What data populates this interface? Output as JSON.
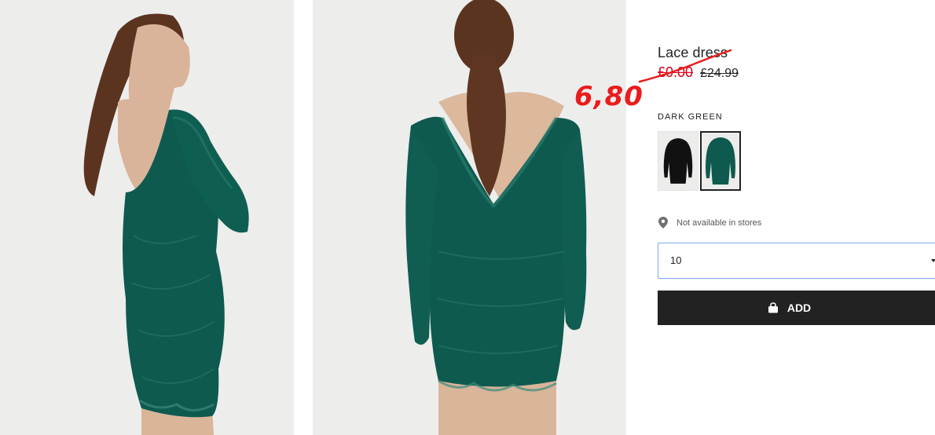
{
  "product": {
    "title": "Lace dress",
    "sale_price": "£0.00",
    "original_price": "£24.99"
  },
  "annotation": {
    "handwritten_price": "6,80",
    "color": "#ea1c1c"
  },
  "color_selector": {
    "label": "DARK GREEN",
    "swatches": [
      {
        "name": "black",
        "selected": false
      },
      {
        "name": "dark-green",
        "selected": true
      }
    ]
  },
  "store_availability": {
    "icon": "location-pin-icon",
    "text": "Not available in stores"
  },
  "size_select": {
    "value": "10",
    "icon": "caret-down-icon"
  },
  "add_button": {
    "label": "ADD",
    "icon": "shopping-bag-icon"
  },
  "colors": {
    "accent": "#d0021b",
    "button_bg": "#222222",
    "select_border": "#7aa7f2",
    "dress_green": "#0e5a4f"
  }
}
